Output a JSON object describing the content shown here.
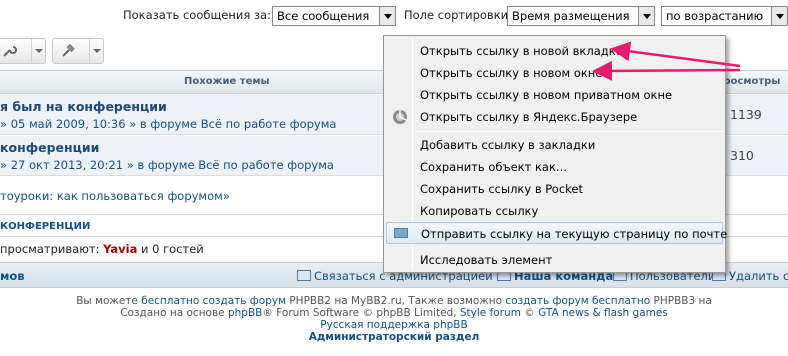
{
  "sortbar": {
    "show_label": "Показать сообщения за:",
    "show_value": "Все сообщения",
    "sort_label": "Поле сортировки",
    "sort_value": "Время размещения",
    "order_value": "по возрастанию"
  },
  "table": {
    "header_topics": "Похожие темы",
    "header_views": "Просмотры",
    "rows": [
      {
        "title": "я был на конференции",
        "meta": "» 05 май 2009, 10:36 » в форуме Всё по работе форума",
        "views": "1139"
      },
      {
        "title": "конференции",
        "meta": "» 27 окт 2013, 20:21 » в форуме Всё по работе форума",
        "views": "310"
      }
    ]
  },
  "tutorial_link": "тоуроки: как пользоваться форумом»",
  "section_title": "КОНФЕРЕНЦИИ",
  "viewers": {
    "prefix": "просматривают:",
    "user": "Yavia",
    "suffix": "и 0 гостей"
  },
  "footer_nav": {
    "left": "мов",
    "contact": "Связаться с администрацией",
    "team": "Наша команда",
    "users": "Пользователи",
    "delete": "Удалить c"
  },
  "copyright": {
    "line1_prefix": "Вы можете",
    "line1_link1": "бесплатно создать форум",
    "line1_mid1": "PHPBB2 на MyBB2.ru, Также возможно",
    "line1_link2": "создать форум бесплатно",
    "line1_suffix": "PHPBB3 на",
    "line2_prefix": "Создано на основе",
    "line2_link1": "phpBB",
    "line2_mid": "® Forum Software © phpBB Limited,",
    "line2_link2": "Style forum",
    "line2_mid2": "©",
    "line2_link3": "GTA news & flash games",
    "support": "Русская поддержка phpBB",
    "admin": "Администраторский раздел"
  },
  "context_menu": {
    "items": [
      "Открыть ссылку в новой вкладке",
      "Открыть ссылку в новом окне",
      "Открыть ссылку в новом приватном окне",
      "Открыть ссылку в Яндекс.Браузере",
      "Добавить ссылку в закладки",
      "Сохранить объект как...",
      "Сохранить ссылку в Pocket",
      "Копировать ссылку",
      "Отправить ссылку на текущую страницу по почте",
      "Исследовать элемент"
    ]
  },
  "colors": {
    "link": "#105289",
    "user": "#aa0000",
    "annotation_arrow": "#e8196e",
    "menu_bg": "#f0f0f0"
  },
  "icons": [
    "wrench-icon",
    "hammer-icon",
    "yandex-browser-icon",
    "mail-icon",
    "chevron-down-icon"
  ]
}
